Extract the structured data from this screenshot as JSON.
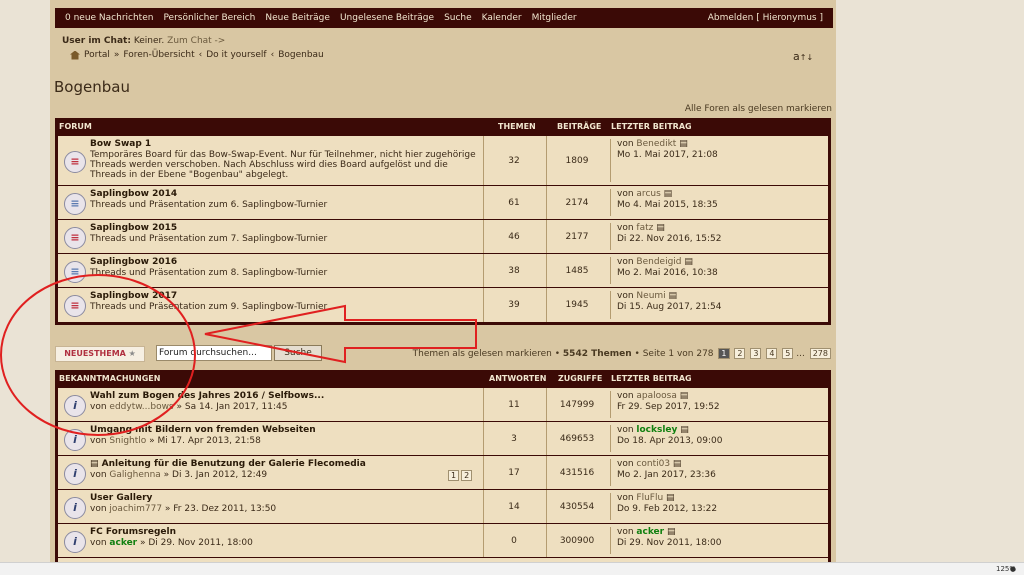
{
  "nav": {
    "messages": "0 neue Nachrichten",
    "items": [
      "Persönlicher Bereich",
      "Neue Beiträge",
      "Ungelesene Beiträge",
      "Suche",
      "Kalender",
      "Mitglieder"
    ],
    "logout": "Abmelden [ Hieronymus ]"
  },
  "chat": {
    "label": "User im Chat:",
    "value": "Keiner.",
    "link": "Zum Chat ->"
  },
  "breadcrumb": [
    "Portal",
    "»",
    "Foren-Übersicht",
    "‹",
    "Do it yourself",
    "‹",
    "Bogenbau"
  ],
  "fontsize_label": "a",
  "page_title": "Bogenbau",
  "mark_all": "Alle Foren als gelesen markieren",
  "forum_table": {
    "headers": [
      "FORUM",
      "THEMEN",
      "BEITRÄGE",
      "LETZTER BEITRAG"
    ],
    "rows": [
      {
        "title": "Bow Swap 1",
        "desc": "Temporäres Board für das Bow-Swap-Event. Nur für Teilnehmer, nicht hier zugehörige Threads werden verschoben. Nach Abschluss wird dies Board aufgelöst und die Threads in der Ebene \"Bogenbau\" abgelegt.",
        "topics": "32",
        "posts": "1809",
        "by": "von",
        "user": "Benedikt",
        "date": "Mo 1. Mai 2017, 21:08"
      },
      {
        "title": "Saplingbow 2014",
        "desc": "Threads und Präsentation zum 6. Saplingbow-Turnier",
        "topics": "61",
        "posts": "2174",
        "by": "von",
        "user": "arcus",
        "date": "Mo 4. Mai 2015, 18:35"
      },
      {
        "title": "Saplingbow 2015",
        "desc": "Threads und Präsentation zum 7. Saplingbow-Turnier",
        "topics": "46",
        "posts": "2177",
        "by": "von",
        "user": "fatz",
        "date": "Di 22. Nov 2016, 15:52"
      },
      {
        "title": "Saplingbow 2016",
        "desc": "Threads und Präsentation zum 8. Saplingbow-Turnier",
        "topics": "38",
        "posts": "1485",
        "by": "von",
        "user": "Bendeigid",
        "date": "Mo 2. Mai 2016, 10:38"
      },
      {
        "title": "Saplingbow 2017",
        "desc": "Threads und Präsentation zum 9. Saplingbow-Turnier",
        "topics": "39",
        "posts": "1945",
        "by": "von",
        "user": "Neumi",
        "date": "Di 15. Aug 2017, 21:54"
      }
    ]
  },
  "toolbar": {
    "new_topic": "NEUESTHEMA",
    "search_placeholder": "Forum durchsuchen...",
    "search_button": "Suche",
    "mark_read": "Themen als gelesen markieren",
    "count": "5542 Themen",
    "page_info": "Seite 1 von 278",
    "pages": [
      "1",
      "2",
      "3",
      "4",
      "5",
      "...",
      "278"
    ]
  },
  "announce_table": {
    "headers": [
      "BEKANNTMACHUNGEN",
      "ANTWORTEN",
      "ZUGRIFFE",
      "LETZTER BEITRAG"
    ],
    "rows": [
      {
        "title": "Wahl zum Bogen des Jahres 2016 / Selfbows...",
        "by": "von",
        "author": "eddytw...bows",
        "date": "» Sa 14. Jan 2017, 11:45",
        "replies": "11",
        "views": "147999",
        "luser": "apaloosa",
        "ldate": "Fr 29. Sep 2017, 19:52"
      },
      {
        "title": "Umgang mit Bildern von fremden Webseiten",
        "by": "von",
        "author": "Snightlo",
        "date": "» Mi 17. Apr 2013, 21:58",
        "replies": "3",
        "views": "469653",
        "luser": "locksley",
        "ldate": "Do 18. Apr 2013, 09:00"
      },
      {
        "title": "Anleitung für die Benutzung der Galerie Flecomedia",
        "by": "von",
        "author": "Galighenna",
        "date": "» Di 3. Jan 2012, 12:49",
        "replies": "17",
        "views": "431516",
        "luser": "conti03",
        "ldate": "Mo 2. Jan 2017, 23:36",
        "pages": [
          "1",
          "2"
        ]
      },
      {
        "title": "User Gallery",
        "by": "von",
        "author": "joachim777",
        "date": "» Fr 23. Dez 2011, 13:50",
        "replies": "14",
        "views": "430554",
        "luser": "FluFlu",
        "ldate": "Do 9. Feb 2012, 13:22"
      },
      {
        "title": "FC Forumsregeln",
        "by": "von",
        "author": "acker",
        "date": "» Di 29. Nov 2011, 18:00",
        "replies": "0",
        "views": "300900",
        "luser": "acker",
        "ldate": "Di 29. Nov 2011, 18:00"
      }
    ]
  },
  "status_zoom": "125%"
}
